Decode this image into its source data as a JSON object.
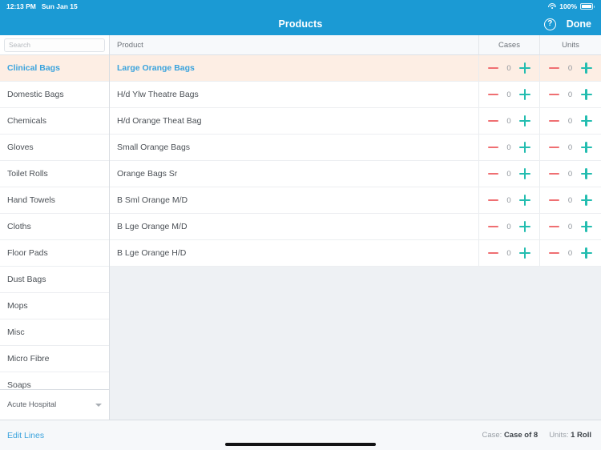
{
  "status_bar": {
    "time": "12:13 PM",
    "date": "Sun Jan 15",
    "battery_percent": "100%",
    "wifi_icon": "wifi-icon",
    "battery_icon": "battery-icon"
  },
  "nav": {
    "title": "Products",
    "help_icon": "question-mark-circle-icon",
    "help_glyph": "?",
    "done_label": "Done"
  },
  "search": {
    "placeholder": "Search",
    "value": ""
  },
  "sidebar": {
    "categories": [
      {
        "label": "Clinical Bags",
        "selected": true
      },
      {
        "label": "Domestic Bags",
        "selected": false
      },
      {
        "label": "Chemicals",
        "selected": false
      },
      {
        "label": "Gloves",
        "selected": false
      },
      {
        "label": "Toilet Rolls",
        "selected": false
      },
      {
        "label": "Hand Towels",
        "selected": false
      },
      {
        "label": "Cloths",
        "selected": false
      },
      {
        "label": "Floor Pads",
        "selected": false
      },
      {
        "label": "Dust Bags",
        "selected": false
      },
      {
        "label": "Mops",
        "selected": false
      },
      {
        "label": "Misc",
        "selected": false
      },
      {
        "label": "Micro Fibre",
        "selected": false
      },
      {
        "label": "Soaps",
        "selected": false
      }
    ],
    "footer": {
      "site": "Acute Hospital",
      "chevron_icon": "chevron-down-icon"
    }
  },
  "table": {
    "columns": {
      "product": "Product",
      "cases": "Cases",
      "units": "Units"
    },
    "rows": [
      {
        "product": "Large Orange Bags",
        "cases": "0",
        "units": "0",
        "selected": true
      },
      {
        "product": "H/d Ylw Theatre Bags",
        "cases": "0",
        "units": "0",
        "selected": false
      },
      {
        "product": "H/d Orange Theat Bag",
        "cases": "0",
        "units": "0",
        "selected": false
      },
      {
        "product": "Small Orange Bags",
        "cases": "0",
        "units": "0",
        "selected": false
      },
      {
        "product": "Orange Bags Sr",
        "cases": "0",
        "units": "0",
        "selected": false
      },
      {
        "product": "B Sml Orange M/D",
        "cases": "0",
        "units": "0",
        "selected": false
      },
      {
        "product": "B Lge Orange M/D",
        "cases": "0",
        "units": "0",
        "selected": false
      },
      {
        "product": "B Lge Orange H/D",
        "cases": "0",
        "units": "0",
        "selected": false
      }
    ]
  },
  "footer": {
    "edit_lines_label": "Edit Lines",
    "case_label": "Case:",
    "case_value": "Case of 8",
    "units_label": "Units:",
    "units_value": "1 Roll"
  },
  "colors": {
    "brand_blue": "#1b9ad4",
    "link_blue": "#3aa3dd",
    "selected_row": "#fdeee4",
    "minus_red": "#ef6f72",
    "plus_teal": "#24bdb0",
    "page_bg": "#eef1f4"
  }
}
